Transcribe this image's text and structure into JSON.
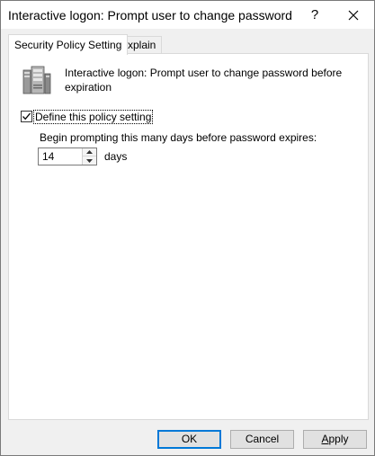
{
  "window": {
    "title": "Interactive logon: Prompt user to change password befor...",
    "help_glyph": "?",
    "close_icon": "close-icon"
  },
  "tabs": [
    {
      "label": "Security Policy Setting",
      "active": true
    },
    {
      "label": "Explain",
      "active": false
    }
  ],
  "policy": {
    "icon": "server-icon",
    "description": "Interactive logon: Prompt user to change password before expiration"
  },
  "define_setting": {
    "label": "Define this policy setting",
    "checked": true
  },
  "prompt": {
    "label": "Begin prompting this many days before password expires:",
    "value": "14",
    "unit": "days"
  },
  "buttons": {
    "ok": "OK",
    "cancel": "Cancel",
    "apply_prefix": "",
    "apply_access": "A",
    "apply_rest": "pply"
  },
  "colors": {
    "focus_border": "#0078d7",
    "button_bg": "#e1e1e1",
    "window_bg": "#f0f0f0"
  }
}
